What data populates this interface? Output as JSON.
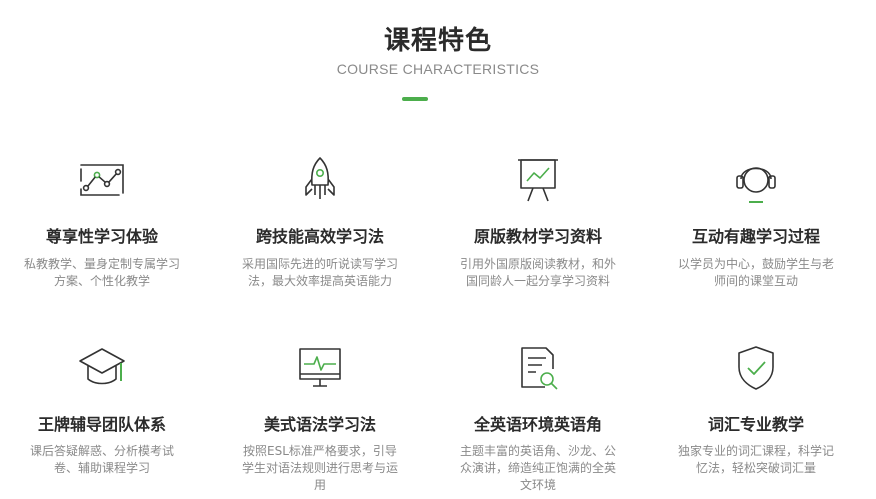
{
  "header": {
    "title": "课程特色",
    "subtitle": "COURSE CHARACTERISTICS"
  },
  "colors": {
    "accent": "#4cae4c",
    "icon_stroke": "#333333",
    "title_text": "#2b2b2b",
    "desc_text": "#8a8a8a"
  },
  "features": [
    {
      "icon": "chart-path-icon",
      "title": "尊享性学习体验",
      "desc": "私教教学、量身定制专属学习方案、个性化教学"
    },
    {
      "icon": "rocket-icon",
      "title": "跨技能高效学习法",
      "desc": "采用国际先进的听说读写学习法，最大效率提高英语能力"
    },
    {
      "icon": "presentation-board-icon",
      "title": "原版教材学习资料",
      "desc": "引用外国原版阅读教材，和外国同龄人一起分享学习资料"
    },
    {
      "icon": "headset-icon",
      "title": "互动有趣学习过程",
      "desc": "以学员为中心，鼓励学生与老师间的课堂互动"
    },
    {
      "icon": "graduation-cap-icon",
      "title": "王牌辅导团队体系",
      "desc": "课后答疑解惑、分析模考试卷、辅助课程学习"
    },
    {
      "icon": "monitor-pulse-icon",
      "title": "美式语法学习法",
      "desc": "按照ESL标准严格要求，引导学生对语法规则进行思考与运用"
    },
    {
      "icon": "document-search-icon",
      "title": "全英语环境英语角",
      "desc": "主题丰富的英语角、沙龙、公众演讲，缔造纯正饱满的全英文环境"
    },
    {
      "icon": "shield-check-icon",
      "title": "词汇专业教学",
      "desc": "独家专业的词汇课程，科学记忆法，轻松突破词汇量"
    }
  ]
}
